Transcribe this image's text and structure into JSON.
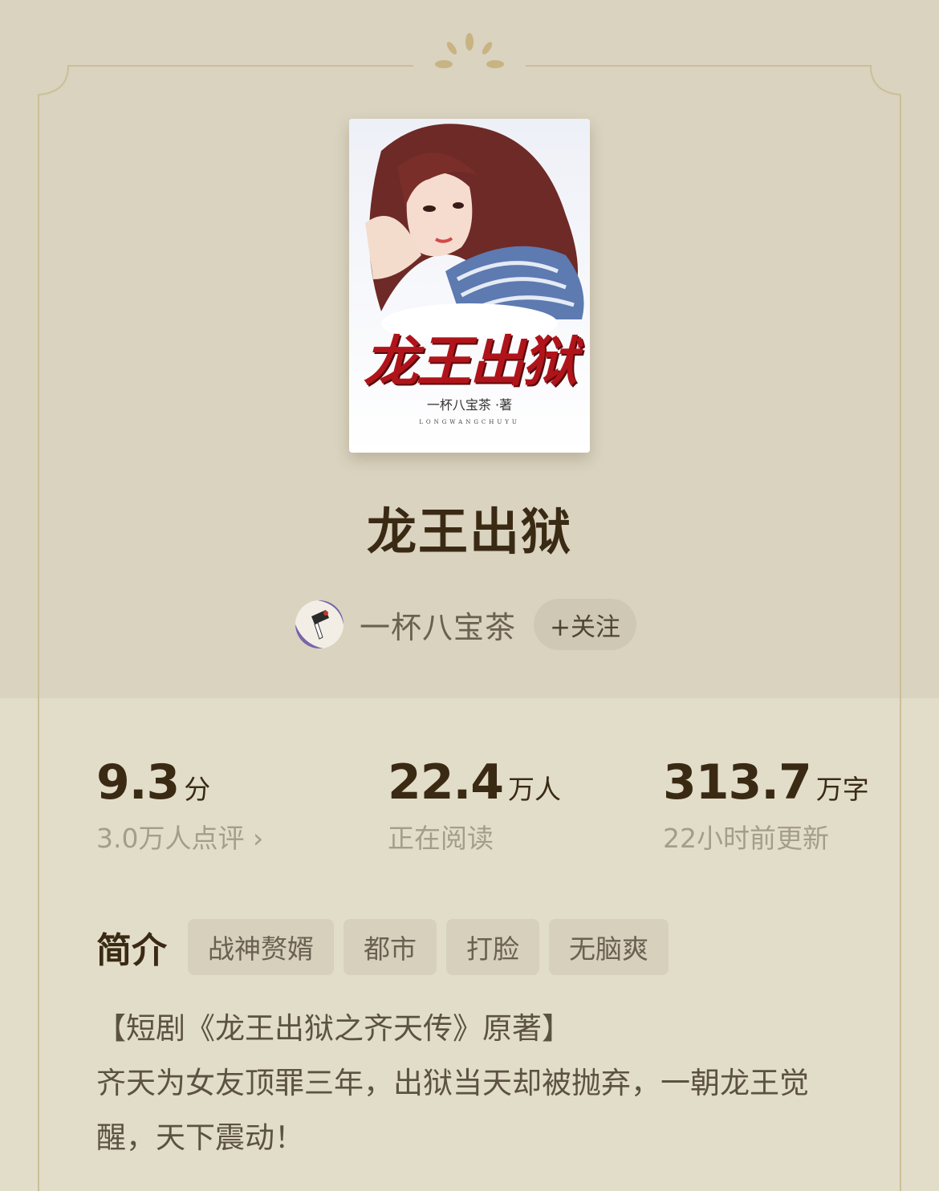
{
  "book": {
    "title": "龙王出狱",
    "cover": {
      "title_text": "龙王出狱",
      "author_text": "一杯八宝茶 ·著",
      "pinyin_text": "LONGWANGCHUYU"
    }
  },
  "author": {
    "name": "一杯八宝茶",
    "follow_label": "+关注"
  },
  "stats": {
    "rating": {
      "value": "9.3",
      "unit": "分",
      "sub": "3.0万人点评 ›"
    },
    "readers": {
      "value": "22.4",
      "unit": "万人",
      "sub": "正在阅读"
    },
    "words": {
      "value": "313.7",
      "unit": "万字",
      "sub": "22小时前更新"
    }
  },
  "intro": {
    "label": "简介",
    "tags": [
      "战神赘婿",
      "都市",
      "打脸",
      "无脑爽"
    ],
    "line1": "【短剧《龙王出狱之齐天传》原著】",
    "line2": "齐天为女友顶罪三年，出狱当天却被抛弃，一朝龙王觉醒，天下震动！"
  },
  "colors": {
    "background": "#e2ddc9",
    "header_background": "#d9d3bf",
    "title_color": "#3a2a14",
    "frame_line": "#c9b98f"
  }
}
